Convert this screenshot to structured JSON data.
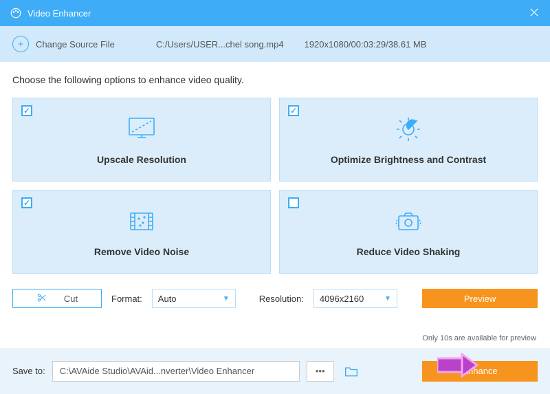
{
  "titlebar": {
    "title": "Video Enhancer"
  },
  "header": {
    "change_label": "Change Source File",
    "file_path": "C:/Users/USER...chel song.mp4",
    "file_meta": "1920x1080/00:03:29/38.61 MB"
  },
  "instruction": "Choose the following options to enhance video quality.",
  "cards": [
    {
      "title": "Upscale Resolution",
      "checked": true
    },
    {
      "title": "Optimize Brightness and Contrast",
      "checked": true
    },
    {
      "title": "Remove Video Noise",
      "checked": true
    },
    {
      "title": "Reduce Video Shaking",
      "checked": false
    }
  ],
  "controls": {
    "cut_label": "Cut",
    "format_label": "Format:",
    "format_value": "Auto",
    "resolution_label": "Resolution:",
    "resolution_value": "4096x2160",
    "preview_label": "Preview",
    "preview_note": "Only 10s are available for preview"
  },
  "footer": {
    "save_to_label": "Save to:",
    "save_path": "C:\\AVAide Studio\\AVAid...nverter\\Video Enhancer",
    "enhance_label": "Enhance"
  }
}
